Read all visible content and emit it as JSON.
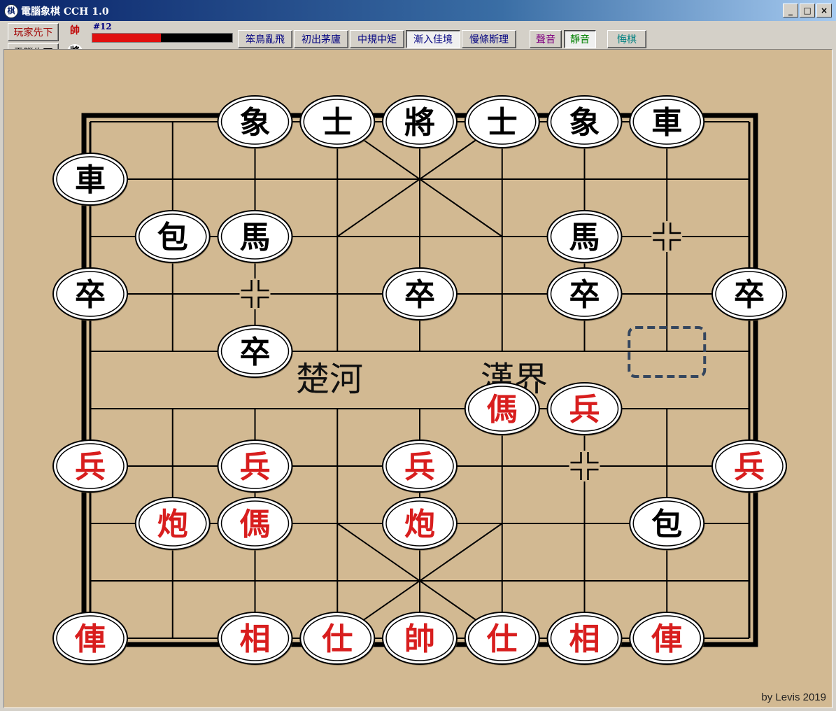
{
  "window": {
    "title": "電腦象棋 CCH 1.0",
    "minimize": "_",
    "maximize": "□",
    "close": "×"
  },
  "toolbar": {
    "player_first": "玩家先下",
    "computer_first": "電腦先下",
    "red_side_glyph": "帥",
    "black_side_glyph": "將",
    "move_number": "#12",
    "progress_fraction": 0.49,
    "difficulty": [
      {
        "label": "笨鳥亂飛",
        "pressed": false
      },
      {
        "label": "初出茅廬",
        "pressed": false
      },
      {
        "label": "中規中矩",
        "pressed": false
      },
      {
        "label": "漸入佳境",
        "pressed": true
      },
      {
        "label": "慢條斯理",
        "pressed": false
      }
    ],
    "sound_on": "聲音",
    "sound_off": "靜音",
    "undo": "悔棋",
    "colors": {
      "sound_on": "#800080",
      "sound_off": "#008000",
      "undo": "#008080",
      "difficulty": "#000080",
      "player": "#a00000",
      "computer": "#000000"
    }
  },
  "board": {
    "river_left": "楚河",
    "river_right": "漢界",
    "credit": "by Levis 2019",
    "colors": {
      "background": "#d2b992",
      "lines": "#000000",
      "red_piece": "#d81e1e",
      "black_piece": "#000000",
      "selection": "#34465e"
    },
    "pieces": [
      {
        "side": "black",
        "char": "車",
        "col": 0,
        "row": 1
      },
      {
        "side": "black",
        "char": "象",
        "col": 2,
        "row": 0
      },
      {
        "side": "black",
        "char": "士",
        "col": 3,
        "row": 0
      },
      {
        "side": "black",
        "char": "將",
        "col": 4,
        "row": 0
      },
      {
        "side": "black",
        "char": "士",
        "col": 5,
        "row": 0
      },
      {
        "side": "black",
        "char": "象",
        "col": 6,
        "row": 0
      },
      {
        "side": "black",
        "char": "車",
        "col": 7,
        "row": 0
      },
      {
        "side": "black",
        "char": "包",
        "col": 1,
        "row": 2
      },
      {
        "side": "black",
        "char": "馬",
        "col": 2,
        "row": 2
      },
      {
        "side": "black",
        "char": "馬",
        "col": 6,
        "row": 2
      },
      {
        "side": "black",
        "char": "卒",
        "col": 0,
        "row": 3
      },
      {
        "side": "black",
        "char": "卒",
        "col": 4,
        "row": 3
      },
      {
        "side": "black",
        "char": "卒",
        "col": 6,
        "row": 3
      },
      {
        "side": "black",
        "char": "卒",
        "col": 8,
        "row": 3
      },
      {
        "side": "black",
        "char": "卒",
        "col": 2,
        "row": 4
      },
      {
        "side": "black",
        "char": "包",
        "col": 7,
        "row": 7
      },
      {
        "side": "red",
        "char": "傌",
        "col": 5,
        "row": 5
      },
      {
        "side": "red",
        "char": "兵",
        "col": 6,
        "row": 5
      },
      {
        "side": "red",
        "char": "兵",
        "col": 0,
        "row": 6
      },
      {
        "side": "red",
        "char": "兵",
        "col": 2,
        "row": 6
      },
      {
        "side": "red",
        "char": "兵",
        "col": 4,
        "row": 6
      },
      {
        "side": "red",
        "char": "兵",
        "col": 8,
        "row": 6
      },
      {
        "side": "red",
        "char": "炮",
        "col": 1,
        "row": 7
      },
      {
        "side": "red",
        "char": "傌",
        "col": 2,
        "row": 7
      },
      {
        "side": "red",
        "char": "炮",
        "col": 4,
        "row": 7
      },
      {
        "side": "red",
        "char": "俥",
        "col": 0,
        "row": 9
      },
      {
        "side": "red",
        "char": "相",
        "col": 2,
        "row": 9
      },
      {
        "side": "red",
        "char": "仕",
        "col": 3,
        "row": 9
      },
      {
        "side": "red",
        "char": "帥",
        "col": 4,
        "row": 9
      },
      {
        "side": "red",
        "char": "仕",
        "col": 5,
        "row": 9
      },
      {
        "side": "red",
        "char": "相",
        "col": 6,
        "row": 9
      },
      {
        "side": "red",
        "char": "俥",
        "col": 7,
        "row": 9
      }
    ],
    "marks": [
      {
        "col": 7,
        "row": 2
      },
      {
        "col": 2,
        "row": 3
      },
      {
        "col": 6,
        "row": 6
      }
    ],
    "selection": {
      "col": 7,
      "row": 4
    }
  }
}
